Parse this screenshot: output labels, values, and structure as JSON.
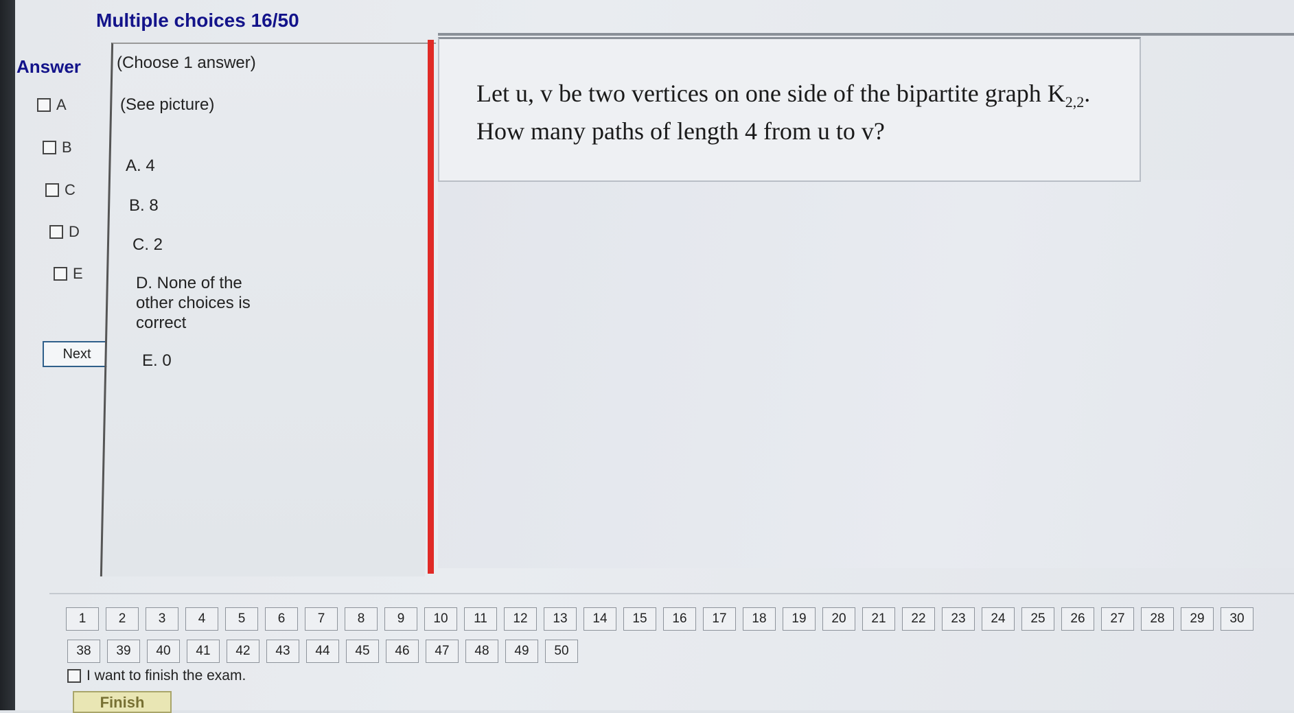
{
  "header": {
    "title": "Multiple choices 16/50"
  },
  "answer_panel": {
    "label": "Answer",
    "options": [
      {
        "letter": "A",
        "checked": false
      },
      {
        "letter": "B",
        "checked": false
      },
      {
        "letter": "C",
        "checked": false
      },
      {
        "letter": "D",
        "checked": false
      },
      {
        "letter": "E",
        "checked": false
      }
    ],
    "next_label": "Next"
  },
  "choices_panel": {
    "instruction": "(Choose 1 answer)",
    "note": "(See picture)",
    "choices": [
      {
        "text": "A. 4"
      },
      {
        "text": "B. 8"
      },
      {
        "text": "C. 2"
      },
      {
        "text": "D. None of the other choices is correct"
      },
      {
        "text": "E. 0"
      }
    ]
  },
  "question": {
    "line1": "Let u, v be two vertices on one side of the bipartite graph K",
    "subscript": "2,2",
    "line1_end": ".",
    "line2": "How many paths of length 4 from u to v?"
  },
  "question_nav": {
    "row1": [
      "1",
      "2",
      "3",
      "4",
      "5",
      "6",
      "7",
      "8",
      "9",
      "10",
      "11",
      "12",
      "13",
      "14",
      "15",
      "16",
      "17",
      "18",
      "19",
      "20",
      "21",
      "22",
      "23",
      "24",
      "25",
      "26",
      "27",
      "28",
      "29",
      "30"
    ],
    "row2": [
      "38",
      "39",
      "40",
      "41",
      "42",
      "43",
      "44",
      "45",
      "46",
      "47",
      "48",
      "49",
      "50"
    ]
  },
  "footer": {
    "finish_checkbox_label": "I want to finish the exam.",
    "finish_button_label": "Finish"
  },
  "colors": {
    "title": "#13138a",
    "divider": "#e02a26",
    "finish_button": "#e9e6b4"
  }
}
